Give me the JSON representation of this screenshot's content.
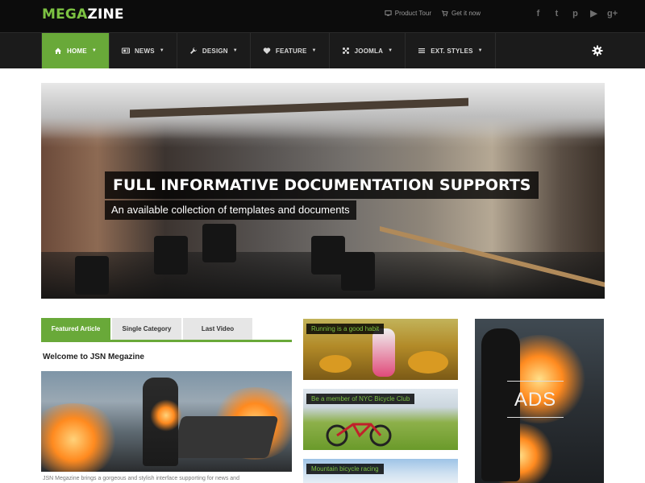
{
  "brand": {
    "part1": "MEGA",
    "part2": "ZINE"
  },
  "top_links": [
    {
      "label": "Product Tour",
      "icon": "monitor-icon"
    },
    {
      "label": "Get it now",
      "icon": "cart-icon"
    }
  ],
  "social": [
    {
      "icon": "facebook-icon",
      "glyph": "f"
    },
    {
      "icon": "twitter-icon",
      "glyph": "t"
    },
    {
      "icon": "pinterest-icon",
      "glyph": "p"
    },
    {
      "icon": "youtube-icon",
      "glyph": "▶"
    },
    {
      "icon": "googleplus-icon",
      "glyph": "g+"
    }
  ],
  "nav": [
    {
      "label": "HOME",
      "icon": "home-icon",
      "active": true
    },
    {
      "label": "NEWS",
      "icon": "news-icon"
    },
    {
      "label": "DESIGN",
      "icon": "wrench-icon"
    },
    {
      "label": "FEATURE",
      "icon": "heart-icon"
    },
    {
      "label": "JOOMLA",
      "icon": "joomla-icon"
    },
    {
      "label": "EXT. STYLES",
      "icon": "list-icon"
    }
  ],
  "settings_icon": "gear-icon",
  "hero": {
    "title": "FULL INFORMATIVE DOCUMENTATION SUPPORTS",
    "subtitle": "An available collection of templates and documents"
  },
  "tabs": [
    "Featured Article",
    "Single Category",
    "Last Video"
  ],
  "active_tab": 0,
  "article": {
    "title": "Welcome to JSN Megazine",
    "excerpt": "JSN Megazine brings a gorgeous and stylish interface supporting for news and"
  },
  "cards": [
    {
      "label": "Running is a good habit"
    },
    {
      "label": "Be a member of NYC Bicycle Club"
    },
    {
      "label": "Mountain bicycle racing"
    }
  ],
  "ads": {
    "label": "ADS"
  },
  "colors": {
    "accent": "#69a939",
    "logo_green": "#7cc242",
    "topbar": "#0c0c0c",
    "navbar": "#1b1b1b"
  }
}
